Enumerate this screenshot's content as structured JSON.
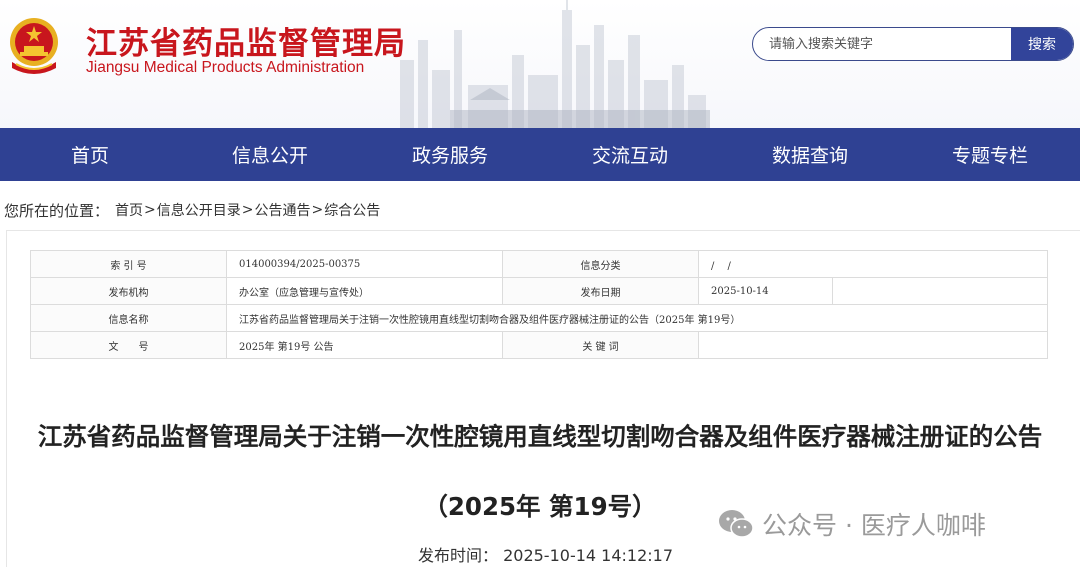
{
  "header": {
    "title_cn": "江苏省药品监督管理局",
    "title_en": "Jiangsu Medical Products Administration",
    "brand_color": "#c8161d",
    "search": {
      "placeholder": "请输入搜索关键字",
      "button_label": "搜索"
    }
  },
  "nav": {
    "color": "#2f4193",
    "items": [
      {
        "label": "首页"
      },
      {
        "label": "信息公开"
      },
      {
        "label": "政务服务"
      },
      {
        "label": "交流互动"
      },
      {
        "label": "数据查询"
      },
      {
        "label": "专题专栏"
      }
    ]
  },
  "breadcrumb": {
    "label": "您所在的位置：",
    "separator": ">",
    "items": [
      "首页",
      "信息公开目录",
      "公告通告",
      "综合公告"
    ]
  },
  "meta": {
    "index_label": "索 引 号",
    "index_value": "014000394/2025-00375",
    "category_label": "信息分类",
    "category_value": "/　 /",
    "publisher_label": "发布机构",
    "publisher_value": "办公室（应急管理与宣传处）",
    "date_label": "发布日期",
    "date_value": "2025-10-14",
    "name_label": "信息名称",
    "name_value": "江苏省药品监督管理局关于注销一次性腔镜用直线型切割吻合器及组件医疗器械注册证的公告（2025年 第19号）",
    "docno_label": "文　　号",
    "docno_value": "2025年 第19号 公告",
    "keyword_label": "关 键 词",
    "keyword_value": ""
  },
  "article": {
    "title": "江苏省药品监督管理局关于注销一次性腔镜用直线型切割吻合器及组件医疗器械注册证的公告",
    "number": "（2025年 第19号）",
    "publish_time": "发布时间： 2025-10-14 14:12:17"
  },
  "watermark": {
    "icon": "wechat-icon",
    "text": "公众号 · 医疗人咖啡"
  }
}
